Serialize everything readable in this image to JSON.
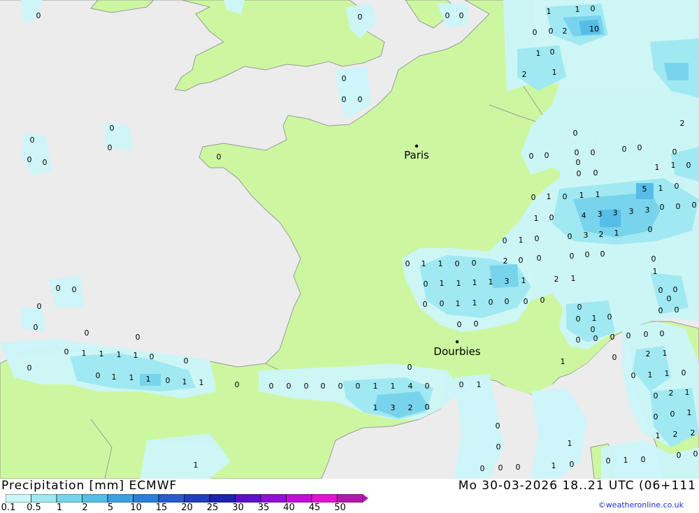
{
  "map": {
    "colors": {
      "sea": "#ececec",
      "land": "#ccf7a0",
      "border": "#aaaaaa",
      "p1": "#cdf6fa",
      "p2": "#a0e9f2",
      "p3": "#78d4ec",
      "p4": "#56bde6"
    },
    "cities": [
      {
        "name": "Paris"
      },
      {
        "name": "Dourbies"
      }
    ]
  },
  "footer": {
    "title": "Precipitation [mm] ECMWF",
    "datetime": "Mo 30-03-2026 18..21 UTC (06+111",
    "credit": "©weatheronline.co.uk",
    "legend": {
      "labels": [
        "0.1",
        "0.5",
        "1",
        "2",
        "5",
        "10",
        "15",
        "20",
        "25",
        "30",
        "35",
        "40",
        "45",
        "50"
      ],
      "colors": [
        "#cdf6fa",
        "#a0e9f2",
        "#78d4ec",
        "#56bde6",
        "#3ea0e0",
        "#2c7ed8",
        "#2a5ccc",
        "#1f3fbe",
        "#1b24aa",
        "#5d12c8",
        "#8f10d8",
        "#c010d8",
        "#e014d0",
        "#b01aaa"
      ]
    }
  }
}
